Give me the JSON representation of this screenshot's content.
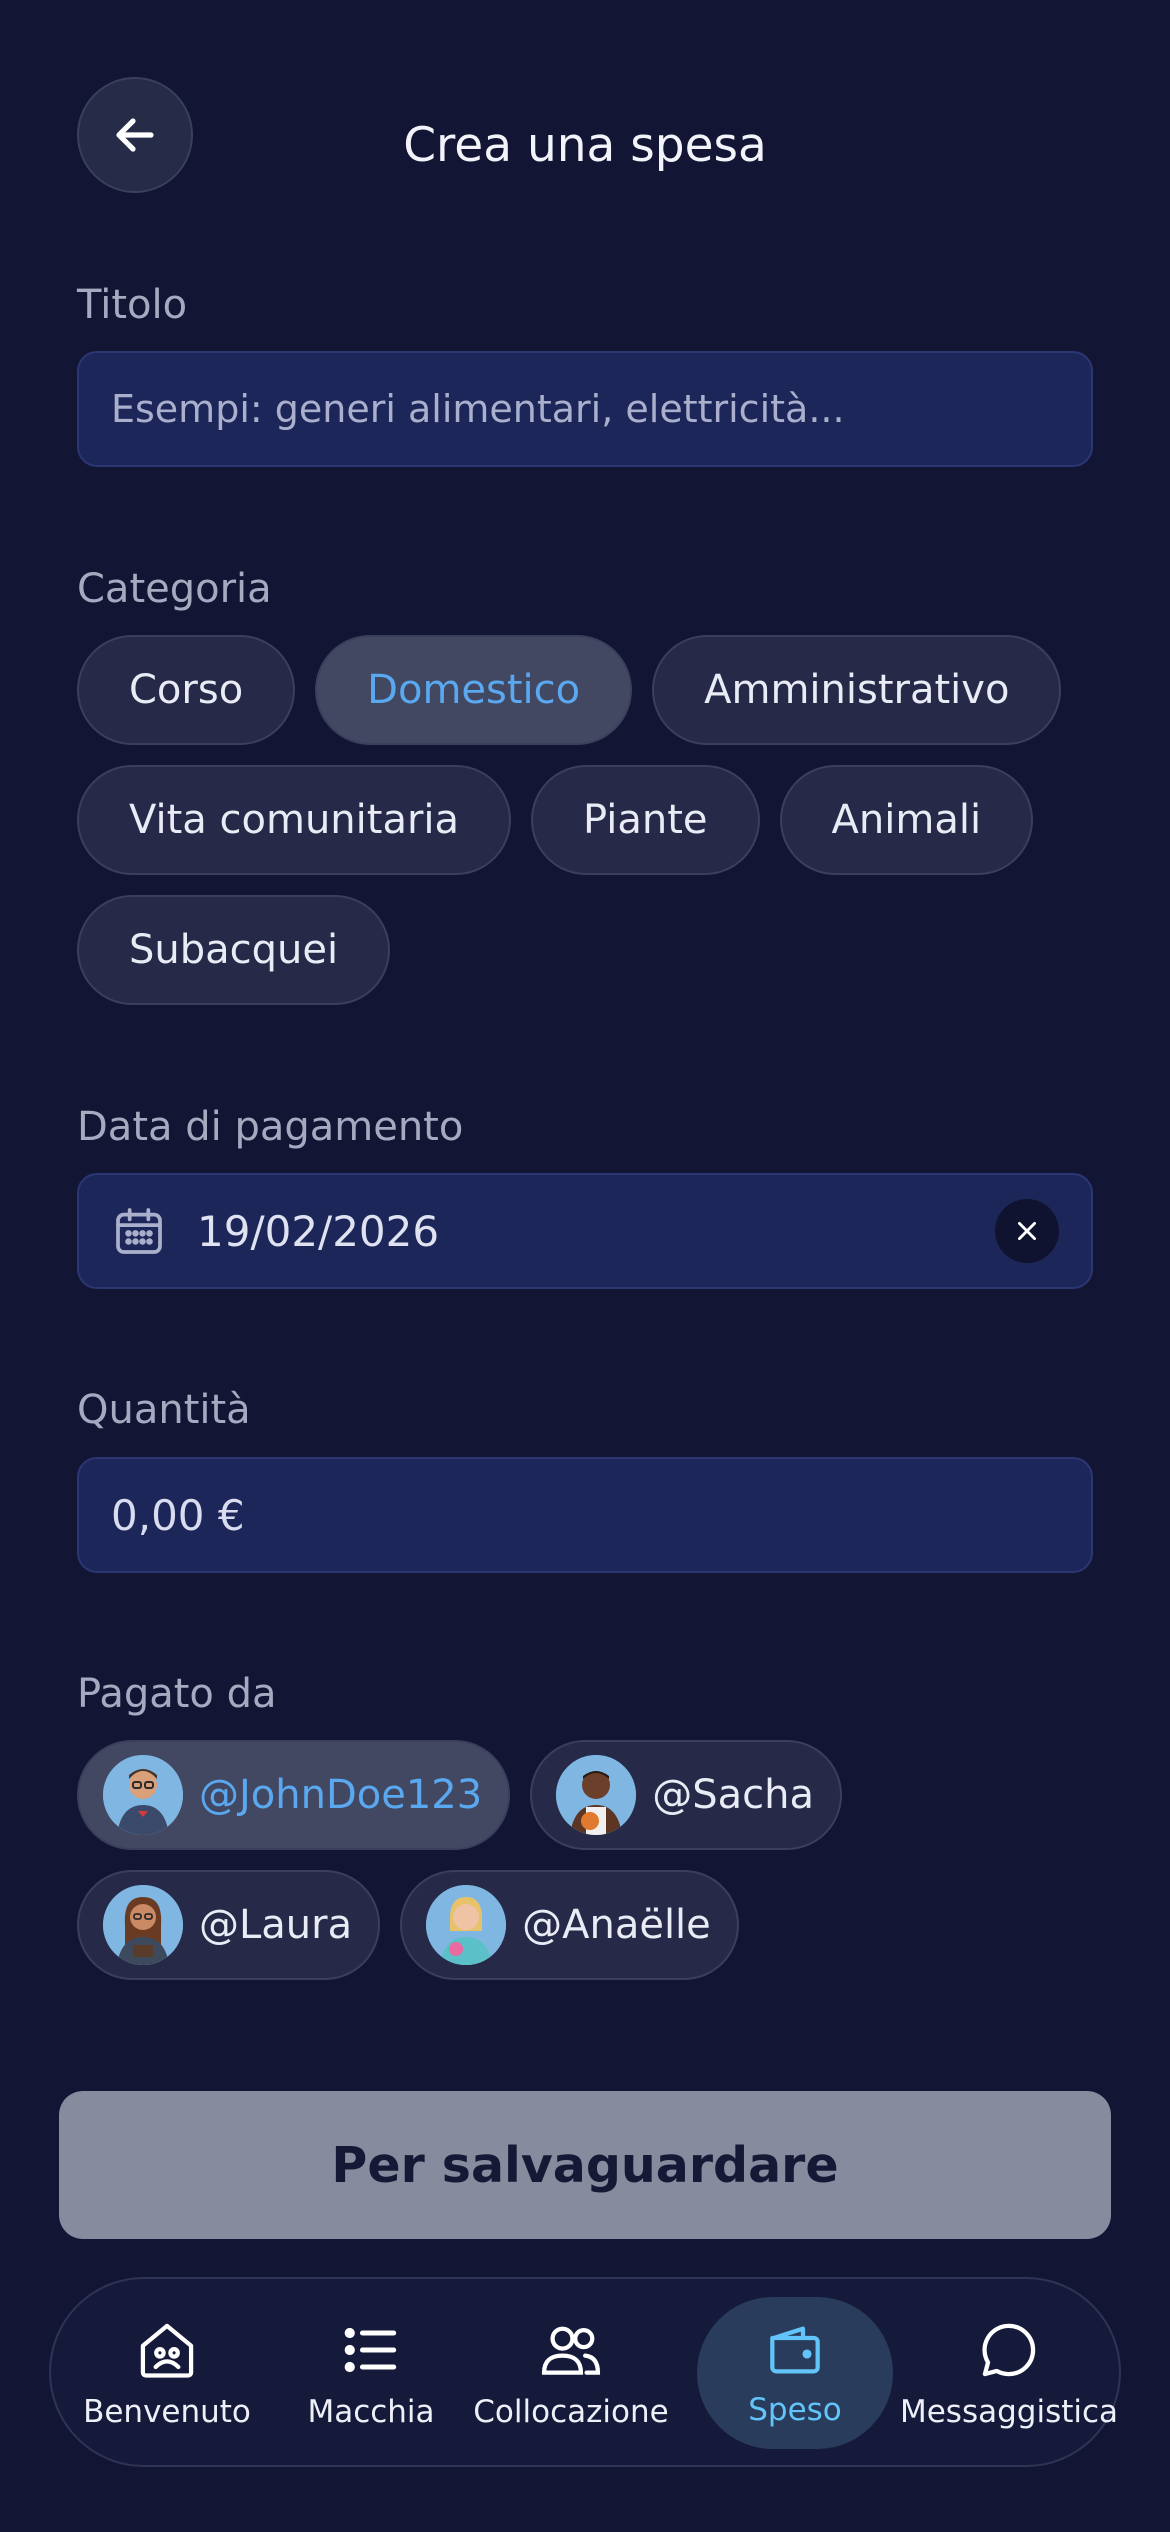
{
  "header": {
    "title": "Crea una spesa"
  },
  "title_section": {
    "label": "Titolo",
    "placeholder": "Esempi: generi alimentari, elettricità..."
  },
  "category": {
    "label": "Categoria",
    "chips": [
      "Corso",
      "Domestico",
      "Amministrativo",
      "Vita comunitaria",
      "Piante",
      "Animali",
      "Subacquei"
    ],
    "selected": "Domestico"
  },
  "payment_date": {
    "label": "Data di pagamento",
    "value": "19/02/2026"
  },
  "amount": {
    "label": "Quantità",
    "value": "0,00 €"
  },
  "paid_by": {
    "label": "Pagato da",
    "users": [
      "@JohnDoe123",
      "@Sacha",
      "@Laura",
      "@Anaëlle"
    ],
    "selected": "@JohnDoe123"
  },
  "save_label": "Per salvaguardare",
  "tabs": [
    "Benvenuto",
    "Macchia",
    "Collocazione",
    "Speso",
    "Messaggistica"
  ],
  "active_tab": "Speso",
  "colors": {
    "background": "#121634",
    "accent": "#5aa8f0",
    "input": "#1d2659",
    "active_tab": "#62c4f8"
  }
}
